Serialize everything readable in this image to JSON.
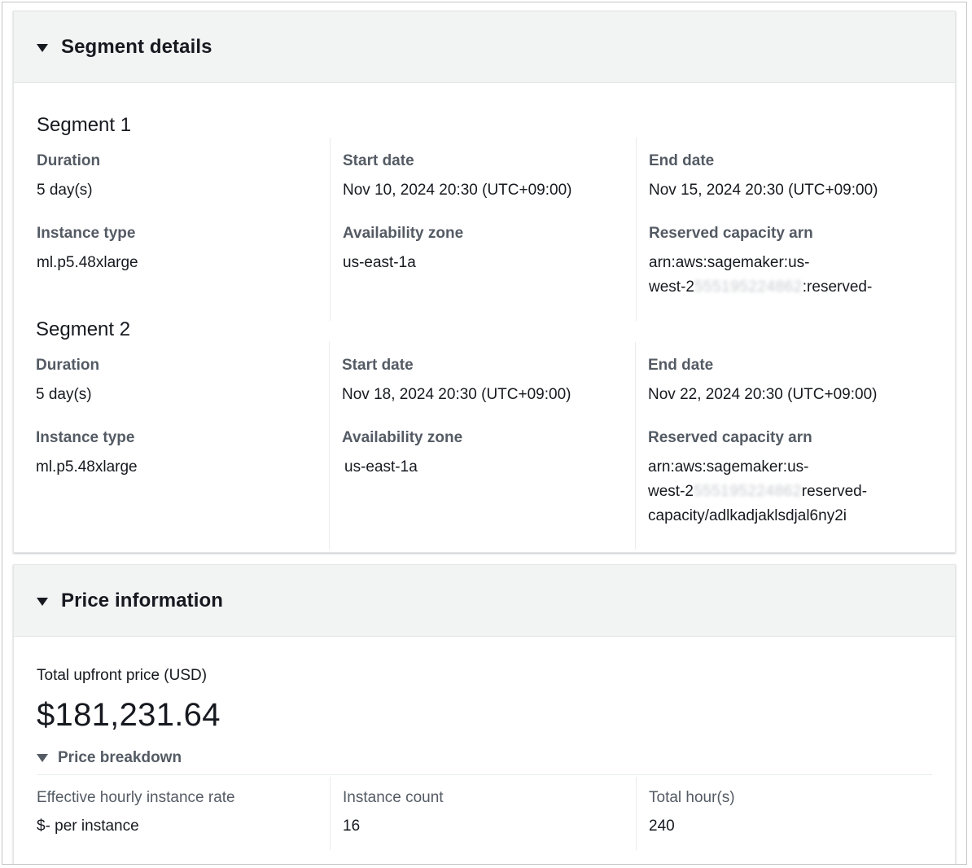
{
  "segment_details": {
    "title": "Segment details",
    "segments": [
      {
        "title": "Segment 1",
        "duration": {
          "label": "Duration",
          "value": "5 day(s)"
        },
        "start_date": {
          "label": "Start date",
          "value": "Nov 10, 2024 20:30 (UTC+09:00)"
        },
        "end_date": {
          "label": "End date",
          "value": "Nov 15, 2024 20:30 (UTC+09:00)"
        },
        "instance_type": {
          "label": "Instance type",
          "value": "ml.p5.48xlarge"
        },
        "availability_zone": {
          "label": "Availability zone",
          "value": "us-east-1a"
        },
        "reserved_capacity_arn": {
          "label": "Reserved capacity arn",
          "line1": "arn:aws:sagemaker:us-",
          "line2_prefix": "west-2",
          "line2_redacted": "555195224862",
          "line2_suffix": ":reserved-"
        }
      },
      {
        "title": "Segment 2",
        "duration": {
          "label": "Duration",
          "value": "5 day(s)"
        },
        "start_date": {
          "label": "Start date",
          "value": "Nov 18, 2024 20:30 (UTC+09:00)"
        },
        "end_date": {
          "label": "End date",
          "value": "Nov 22, 2024 20:30 (UTC+09:00)"
        },
        "instance_type": {
          "label": "Instance type",
          "value": "ml.p5.48xlarge"
        },
        "availability_zone": {
          "label": "Availability zone",
          "value": "us-east-1a"
        },
        "reserved_capacity_arn": {
          "label": "Reserved capacity arn",
          "line1": "arn:aws:sagemaker:us-",
          "line2_prefix": "west-2",
          "line2_redacted": "555195224862",
          "line2_suffix": "reserved-",
          "line3": "capacity/adlkadjaklsdjal6ny2i"
        }
      }
    ]
  },
  "price_information": {
    "title": "Price information",
    "total_label": "Total upfront price (USD)",
    "total_value": "$181,231.64",
    "breakdown_label": "Price breakdown",
    "hourly_rate": {
      "label": "Effective hourly instance rate",
      "value": "$- per instance"
    },
    "instance_count": {
      "label": "Instance count",
      "value": "16"
    },
    "total_hours": {
      "label": "Total hour(s)",
      "value": "240"
    }
  }
}
